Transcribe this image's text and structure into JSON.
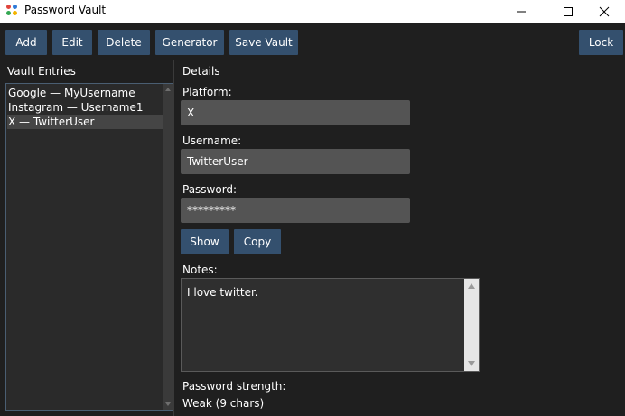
{
  "window": {
    "title": "Password Vault",
    "icon": "app-logo-icon",
    "controls": [
      "minimize-icon",
      "maximize-icon",
      "close-icon"
    ]
  },
  "toolbar": {
    "add_label": "Add",
    "edit_label": "Edit",
    "delete_label": "Delete",
    "generator_label": "Generator",
    "save_label": "Save Vault",
    "lock_label": "Lock"
  },
  "vault": {
    "heading": "Vault Entries",
    "entries": [
      "Google — MyUsername",
      "Instagram — Username1",
      "X — TwitterUser"
    ],
    "selected_index": 2
  },
  "details": {
    "heading": "Details",
    "platform_label": "Platform:",
    "platform_value": "X",
    "username_label": "Username:",
    "username_value": "TwitterUser",
    "password_label": "Password:",
    "password_value": "*********",
    "show_label": "Show",
    "copy_label": "Copy",
    "notes_label": "Notes:",
    "notes_value": "I love twitter.",
    "strength_label": "Password strength:",
    "strength_value": "Weak (9 chars)"
  },
  "colors": {
    "background": "#1f1f1f",
    "button": "#34506e",
    "entry": "#545454",
    "list_selected": "#454545"
  }
}
